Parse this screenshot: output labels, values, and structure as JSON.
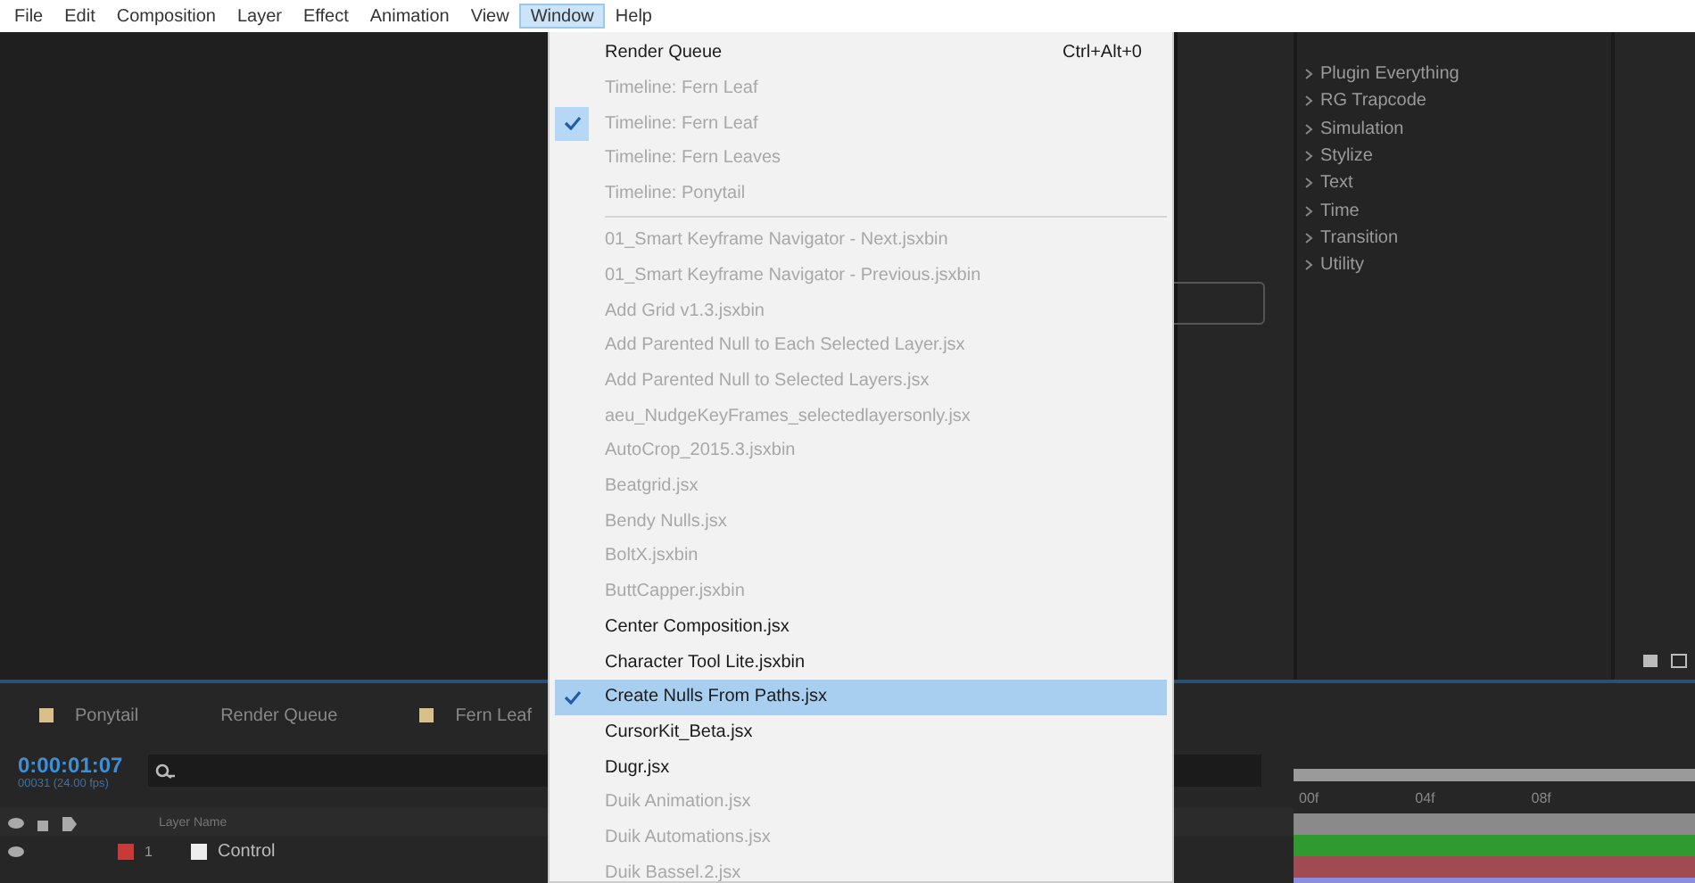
{
  "menubar": [
    {
      "label": "File",
      "selected": false
    },
    {
      "label": "Edit",
      "selected": false
    },
    {
      "label": "Composition",
      "selected": false
    },
    {
      "label": "Layer",
      "selected": false
    },
    {
      "label": "Effect",
      "selected": false
    },
    {
      "label": "Animation",
      "selected": false
    },
    {
      "label": "View",
      "selected": false
    },
    {
      "label": "Window",
      "selected": true
    },
    {
      "label": "Help",
      "selected": false
    }
  ],
  "window_menu": [
    {
      "kind": "item",
      "label": "Render Queue",
      "shortcut": "Ctrl+Alt+0",
      "checked": false,
      "disabled": false,
      "selected": false
    },
    {
      "kind": "item",
      "label": "Timeline: Fern Leaf",
      "checked": false,
      "disabled": true,
      "selected": false
    },
    {
      "kind": "item",
      "label": "Timeline: Fern Leaf",
      "checked": true,
      "disabled": true,
      "selected": false
    },
    {
      "kind": "item",
      "label": "Timeline: Fern Leaves",
      "checked": false,
      "disabled": true,
      "selected": false
    },
    {
      "kind": "item",
      "label": "Timeline: Ponytail",
      "checked": false,
      "disabled": true,
      "selected": false
    },
    {
      "kind": "separator"
    },
    {
      "kind": "item",
      "label": "01_Smart Keyframe Navigator - Next.jsxbin",
      "checked": false,
      "disabled": true,
      "selected": false
    },
    {
      "kind": "item",
      "label": "01_Smart Keyframe Navigator - Previous.jsxbin",
      "checked": false,
      "disabled": true,
      "selected": false
    },
    {
      "kind": "item",
      "label": "Add Grid v1.3.jsxbin",
      "checked": false,
      "disabled": true,
      "selected": false
    },
    {
      "kind": "item",
      "label": "Add Parented Null to Each Selected Layer.jsx",
      "checked": false,
      "disabled": true,
      "selected": false
    },
    {
      "kind": "item",
      "label": "Add Parented Null to Selected Layers.jsx",
      "checked": false,
      "disabled": true,
      "selected": false
    },
    {
      "kind": "item",
      "label": "aeu_NudgeKeyFrames_selectedlayersonly.jsx",
      "checked": false,
      "disabled": true,
      "selected": false
    },
    {
      "kind": "item",
      "label": "AutoCrop_2015.3.jsxbin",
      "checked": false,
      "disabled": true,
      "selected": false
    },
    {
      "kind": "item",
      "label": "Beatgrid.jsx",
      "checked": false,
      "disabled": true,
      "selected": false
    },
    {
      "kind": "item",
      "label": "Bendy Nulls.jsx",
      "checked": false,
      "disabled": true,
      "selected": false
    },
    {
      "kind": "item",
      "label": "BoltX.jsxbin",
      "checked": false,
      "disabled": true,
      "selected": false
    },
    {
      "kind": "item",
      "label": "ButtCapper.jsxbin",
      "checked": false,
      "disabled": true,
      "selected": false
    },
    {
      "kind": "item",
      "label": "Center Composition.jsx",
      "checked": false,
      "disabled": false,
      "selected": false
    },
    {
      "kind": "item",
      "label": "Character Tool Lite.jsxbin",
      "checked": false,
      "disabled": false,
      "selected": false
    },
    {
      "kind": "item",
      "label": "Create Nulls From Paths.jsx",
      "checked": true,
      "disabled": false,
      "selected": true
    },
    {
      "kind": "item",
      "label": "CursorKit_Beta.jsx",
      "checked": false,
      "disabled": false,
      "selected": false
    },
    {
      "kind": "item",
      "label": "Dugr.jsx",
      "checked": false,
      "disabled": false,
      "selected": false
    },
    {
      "kind": "item",
      "label": "Duik Animation.jsx",
      "checked": false,
      "disabled": true,
      "selected": false
    },
    {
      "kind": "item",
      "label": "Duik Automations.jsx",
      "checked": false,
      "disabled": true,
      "selected": false
    },
    {
      "kind": "item",
      "label": "Duik Bassel.2.jsx",
      "checked": false,
      "disabled": true,
      "selected": false
    }
  ],
  "effects_panel": {
    "items": [
      {
        "label": "Plugin Everything"
      },
      {
        "label": "RG Trapcode"
      },
      {
        "label": "Simulation"
      },
      {
        "label": "Stylize"
      },
      {
        "label": "Text"
      },
      {
        "label": "Time"
      },
      {
        "label": "Transition"
      },
      {
        "label": "Utility"
      }
    ]
  },
  "timeline": {
    "tabs": [
      {
        "label": "Ponytail",
        "icon": true
      },
      {
        "label": "Render Queue",
        "icon": false
      },
      {
        "label": "Fern Leaf",
        "icon": true
      }
    ],
    "timecode": "0:00:01:07",
    "frame_info": "00031 (24.00 fps)",
    "column_header": "Layer Name",
    "layers": [
      {
        "number": "1",
        "name": "Control",
        "color": "#c83a3a"
      }
    ],
    "ruler": [
      "00f",
      "04f",
      "08f"
    ],
    "tracks": [
      {
        "color": "#2f9a2f"
      },
      {
        "color": "#a04a52"
      },
      {
        "color": "#8a8ee0"
      }
    ]
  }
}
